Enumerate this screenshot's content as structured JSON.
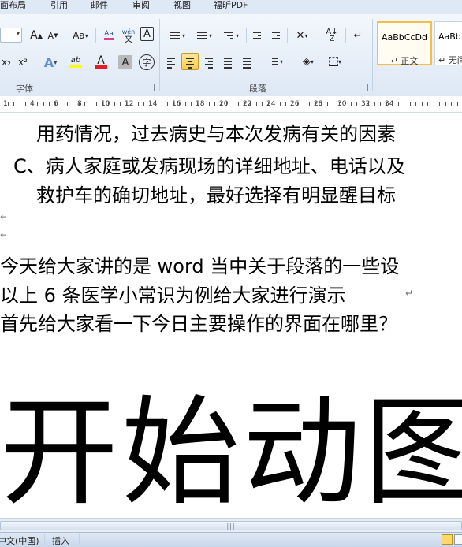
{
  "tabs": [
    "面布局",
    "引用",
    "邮件",
    "审阅",
    "视图",
    "福昕PDF"
  ],
  "font_group": {
    "label": "字体",
    "grow": "A",
    "shrink": "A",
    "case": "Aa",
    "phonetic": "wén",
    "border_char": "A",
    "subscript": "x₂",
    "superscript": "x²",
    "text_effect": "A",
    "highlight": "ab",
    "font_color": "A",
    "char_shading": "A",
    "enclose": "字",
    "highlight_color": "#ffff00",
    "font_color_value": "#e31b23"
  },
  "paragraph_group": {
    "label": "段落"
  },
  "styles": [
    {
      "sample": "AaBbCcDd",
      "name": "↵ 正文"
    },
    {
      "sample": "AaBb",
      "name": "↵ 无间"
    }
  ],
  "ruler": {
    "numbers": [
      "1",
      "4",
      "6",
      "8",
      "10",
      "12",
      "14",
      "16",
      "18",
      "20",
      "22",
      "24",
      "26",
      "28",
      "30",
      "32",
      "34"
    ]
  },
  "document": {
    "lines": [
      "用药情况，过去病史与本次发病有关的因素",
      "C、病人家庭或发病现场的详细地址、电话以及",
      "救护车的确切地址，最好选择有明显醒目标",
      "今天给大家讲的是 word 当中关于段落的一些设",
      "以上 6 条医学小常识为例给大家进行演示",
      "首先给大家看一下今日主要操作的界面在哪里？"
    ],
    "big_text": "开始动图"
  },
  "status": {
    "language": "中文(中国)",
    "mode": "插入"
  }
}
